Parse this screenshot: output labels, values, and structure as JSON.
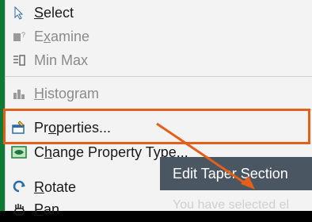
{
  "menu": {
    "items": [
      {
        "label_u": "S",
        "label_rest": "elect",
        "icon": "cursor-arrow-icon"
      },
      {
        "label_pre": "E",
        "label_u": "x",
        "label_rest": "amine",
        "icon": "examine-icon"
      },
      {
        "label": "Min Max",
        "icon": "min-max-icon"
      },
      {
        "label_u": "H",
        "label_rest": "istogram",
        "icon": "histogram-icon"
      },
      {
        "label_pre": "Pr",
        "label_u": "o",
        "label_rest": "perties...",
        "icon": "properties-icon"
      },
      {
        "label_pre": "C",
        "label_u": "h",
        "label_rest": "ange Property Type...",
        "icon": "change-property-icon"
      },
      {
        "label_u": "R",
        "label_rest": "otate",
        "icon": "rotate-icon"
      },
      {
        "label_u": "P",
        "label_rest": "an",
        "icon": "pan-icon"
      }
    ]
  },
  "tooltip": {
    "text": "Edit Taper Section"
  },
  "below_text": "You have selected el",
  "colors": {
    "highlight": "#e35f1a",
    "tooltip_bg": "#4b5663"
  }
}
